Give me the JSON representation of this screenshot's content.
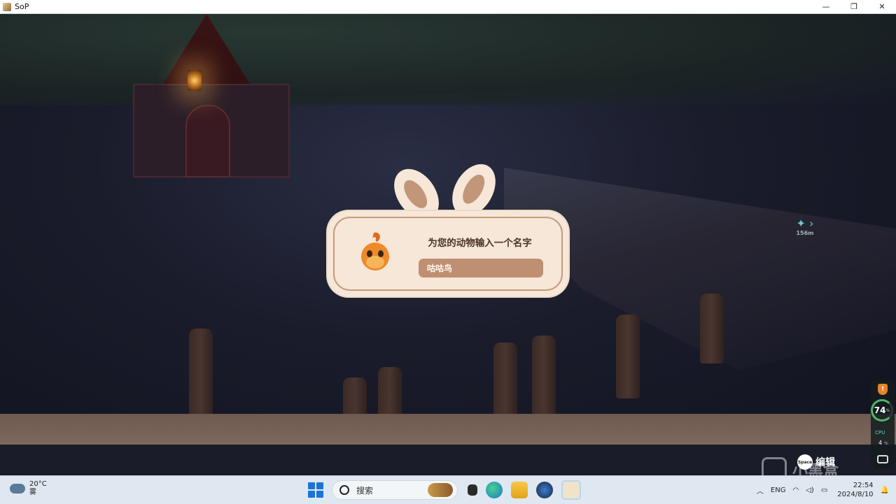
{
  "window": {
    "title": "SoP",
    "minimize": "—",
    "maximize": "❐",
    "close": "✕"
  },
  "dialog": {
    "prompt": "为您的动物输入一个名字",
    "name_value": "咕咕鸟"
  },
  "waypoint": {
    "distance": "156m"
  },
  "hud": {
    "percent": "74",
    "percent_unit": "%",
    "cpu_label": "CPU",
    "cpu_value": "4",
    "cpu_unit": "%",
    "key_badge": "Space",
    "key_action": "编辑",
    "shield_mark": "!",
    "watermark": "小黑盒"
  },
  "taskbar": {
    "weather_temp": "20°C",
    "weather_desc": "雾",
    "search_placeholder": "搜索",
    "tray_chevron": "︿",
    "language": "ENG",
    "time": "22:54",
    "date": "2024/8/10"
  }
}
